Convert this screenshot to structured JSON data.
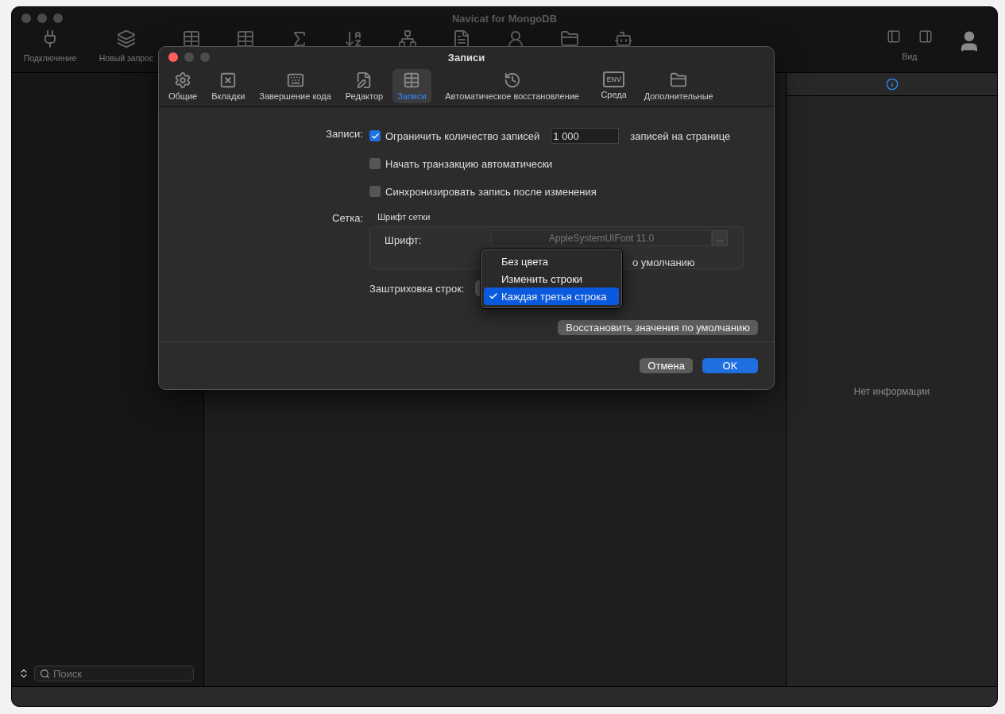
{
  "window": {
    "title": "Navicat for MongoDB"
  },
  "toolbar": {
    "items": [
      {
        "label": "Подключение"
      },
      {
        "label": "Новый запрос"
      }
    ],
    "view_label": "Вид"
  },
  "sidebar": {
    "search": {
      "placeholder": "Поиск"
    }
  },
  "info_panel": {
    "empty_text": "Нет информации"
  },
  "dialog": {
    "title": "Записи",
    "tabs": [
      {
        "label": "Общие",
        "selected": false
      },
      {
        "label": "Вкладки",
        "selected": false
      },
      {
        "label": "Завершение кода",
        "selected": false
      },
      {
        "label": "Редактор",
        "selected": false
      },
      {
        "label": "Записи",
        "selected": true
      },
      {
        "label": "Автоматическое восстановление",
        "selected": false
      },
      {
        "label": "Среда",
        "selected": false,
        "icon_text": "ENV"
      },
      {
        "label": "Дополнительные",
        "selected": false
      }
    ],
    "records": {
      "label": "Записи:",
      "options": [
        {
          "label": "Ограничить количество записей",
          "checked": true,
          "value": "1 000",
          "suffix": "записей на странице"
        },
        {
          "label": "Начать транзакцию автоматически",
          "checked": false
        },
        {
          "label": "Синхронизировать запись после изменения",
          "checked": false
        }
      ]
    },
    "grid": {
      "label": "Сетка:",
      "group_title": "Шрифт сетки",
      "font_label": "Шрифт:",
      "font_value": "AppleSystemUIFont 11.0",
      "font_button": "...",
      "partial_text": "о умолчанию",
      "shading_label": "Заштриховка строк:"
    },
    "shading_menu": [
      {
        "label": "Без цвета",
        "selected": false
      },
      {
        "label": "Изменить строки",
        "selected": false
      },
      {
        "label": "Каждая третья строка",
        "selected": true
      }
    ],
    "restore_button": "Восстановить значения по умолчанию",
    "buttons": [
      {
        "label": "Отмена",
        "kind": "secondary"
      },
      {
        "label": "OK",
        "kind": "primary"
      }
    ]
  }
}
